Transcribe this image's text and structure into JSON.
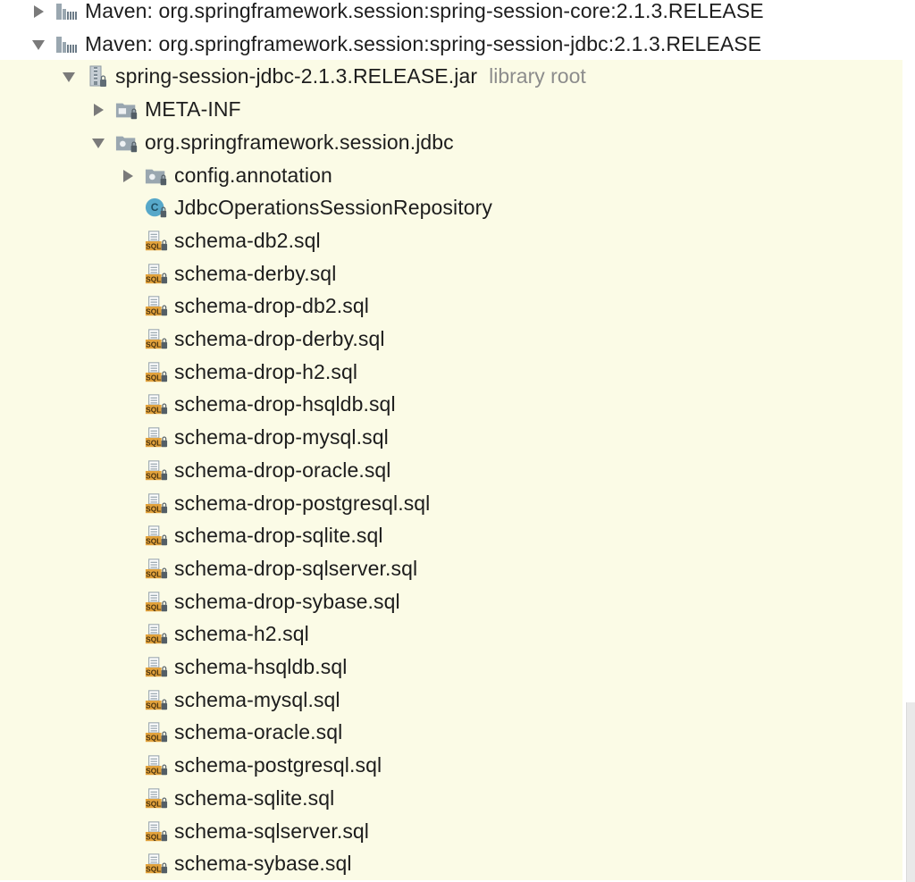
{
  "tree": {
    "rows": [
      {
        "label": "Maven: org.springframework.session:spring-session-core:2.1.3.RELEASE",
        "hint": "",
        "icon": "maven-library-icon",
        "toggle": "collapsed",
        "level": 0
      },
      {
        "label": "Maven: org.springframework.session:spring-session-jdbc:2.1.3.RELEASE",
        "hint": "",
        "icon": "maven-library-icon",
        "toggle": "expanded",
        "level": 0
      },
      {
        "label": "spring-session-jdbc-2.1.3.RELEASE.jar",
        "hint": "library root",
        "icon": "jar-icon",
        "toggle": "expanded",
        "level": 1
      },
      {
        "label": "META-INF",
        "hint": "",
        "icon": "folder-icon",
        "toggle": "collapsed",
        "level": 2
      },
      {
        "label": "org.springframework.session.jdbc",
        "hint": "",
        "icon": "package-icon",
        "toggle": "expanded",
        "level": 2
      },
      {
        "label": "config.annotation",
        "hint": "",
        "icon": "package-icon",
        "toggle": "collapsed",
        "level": 3
      },
      {
        "label": "JdbcOperationsSessionRepository",
        "hint": "",
        "icon": "class-icon",
        "toggle": "none",
        "level": 3
      },
      {
        "label": "schema-db2.sql",
        "hint": "",
        "icon": "sql-file-icon",
        "toggle": "none",
        "level": 3
      },
      {
        "label": "schema-derby.sql",
        "hint": "",
        "icon": "sql-file-icon",
        "toggle": "none",
        "level": 3
      },
      {
        "label": "schema-drop-db2.sql",
        "hint": "",
        "icon": "sql-file-icon",
        "toggle": "none",
        "level": 3
      },
      {
        "label": "schema-drop-derby.sql",
        "hint": "",
        "icon": "sql-file-icon",
        "toggle": "none",
        "level": 3
      },
      {
        "label": "schema-drop-h2.sql",
        "hint": "",
        "icon": "sql-file-icon",
        "toggle": "none",
        "level": 3
      },
      {
        "label": "schema-drop-hsqldb.sql",
        "hint": "",
        "icon": "sql-file-icon",
        "toggle": "none",
        "level": 3
      },
      {
        "label": "schema-drop-mysql.sql",
        "hint": "",
        "icon": "sql-file-icon",
        "toggle": "none",
        "level": 3
      },
      {
        "label": "schema-drop-oracle.sql",
        "hint": "",
        "icon": "sql-file-icon",
        "toggle": "none",
        "level": 3
      },
      {
        "label": "schema-drop-postgresql.sql",
        "hint": "",
        "icon": "sql-file-icon",
        "toggle": "none",
        "level": 3
      },
      {
        "label": "schema-drop-sqlite.sql",
        "hint": "",
        "icon": "sql-file-icon",
        "toggle": "none",
        "level": 3
      },
      {
        "label": "schema-drop-sqlserver.sql",
        "hint": "",
        "icon": "sql-file-icon",
        "toggle": "none",
        "level": 3
      },
      {
        "label": "schema-drop-sybase.sql",
        "hint": "",
        "icon": "sql-file-icon",
        "toggle": "none",
        "level": 3
      },
      {
        "label": "schema-h2.sql",
        "hint": "",
        "icon": "sql-file-icon",
        "toggle": "none",
        "level": 3
      },
      {
        "label": "schema-hsqldb.sql",
        "hint": "",
        "icon": "sql-file-icon",
        "toggle": "none",
        "level": 3
      },
      {
        "label": "schema-mysql.sql",
        "hint": "",
        "icon": "sql-file-icon",
        "toggle": "none",
        "level": 3
      },
      {
        "label": "schema-oracle.sql",
        "hint": "",
        "icon": "sql-file-icon",
        "toggle": "none",
        "level": 3
      },
      {
        "label": "schema-postgresql.sql",
        "hint": "",
        "icon": "sql-file-icon",
        "toggle": "none",
        "level": 3
      },
      {
        "label": "schema-sqlite.sql",
        "hint": "",
        "icon": "sql-file-icon",
        "toggle": "none",
        "level": 3
      },
      {
        "label": "schema-sqlserver.sql",
        "hint": "",
        "icon": "sql-file-icon",
        "toggle": "none",
        "level": 3
      },
      {
        "label": "schema-sybase.sql",
        "hint": "",
        "icon": "sql-file-icon",
        "toggle": "none",
        "level": 3
      }
    ]
  },
  "colors": {
    "library_background": "#fbfbe6",
    "hint_text": "#8c8c8c",
    "class_icon": "#57a8c9",
    "sql_icon": "#e2a23c",
    "folder_icon": "#9aa7b0"
  }
}
